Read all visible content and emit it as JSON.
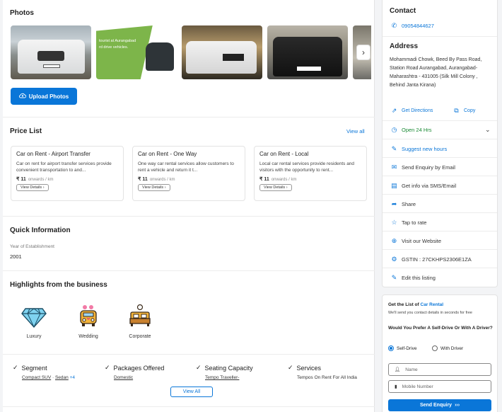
{
  "photos": {
    "title": "Photos",
    "overlay_text_line1": "tourist at Aurangabad",
    "overlay_text_line2": "rd drive vehicles.",
    "upload_label": "Upload Photos"
  },
  "price_list": {
    "title": "Price List",
    "view_all": "View all",
    "cards": [
      {
        "title": "Car on Rent - Airport Transfer",
        "desc": "Car on rent for airport transfer services provide convenient transportation to and...",
        "price": "₹ 11",
        "unit": "onwards / km",
        "button": "View Details"
      },
      {
        "title": "Car on Rent - One Way",
        "desc": "One way car rental services allow customers to rent a vehicle and return it t...",
        "price": "₹ 11",
        "unit": "onwards / km",
        "button": "View Details"
      },
      {
        "title": "Car on Rent - Local",
        "desc": "Local car rental services provide residents and visitors with the opportunity to rent...",
        "price": "₹ 11",
        "unit": "onwards / km",
        "button": "View Details"
      }
    ]
  },
  "quick_info": {
    "title": "Quick Information",
    "label": "Year of Establishment",
    "value": "2001"
  },
  "highlights": {
    "title": "Highlights from the business",
    "items": [
      {
        "label": "Luxury",
        "icon": "diamond-icon"
      },
      {
        "label": "Wedding",
        "icon": "wedding-car-icon"
      },
      {
        "label": "Corporate",
        "icon": "corporate-bed-icon"
      }
    ]
  },
  "features": {
    "items": [
      {
        "title": "Segment",
        "value_a": "Compact SUV",
        "value_b": "Sedan",
        "extra": "+4"
      },
      {
        "title": "Packages Offered",
        "value_a": "Domestic",
        "value_b": "",
        "extra": ""
      },
      {
        "title": "Seating Capacity",
        "value_a": "Tempo Traveller-",
        "value_b": "",
        "extra": ""
      },
      {
        "title": "Services",
        "value_a": "Tempos On Rent For All India",
        "value_b": "",
        "extra": ""
      }
    ],
    "view_all": "View All"
  },
  "side": {
    "contact_title": "Contact",
    "phone": "09054844627",
    "address_title": "Address",
    "address": "Mohammadi Chowk, Beed By Pass Road, Station Road Aurangabad, Aurangabad-Maharashtra - 431005 (Silk Mill Colony , Behind Janta Kirana)",
    "get_directions": "Get Directions",
    "copy": "Copy",
    "hours": "Open 24 Hrs",
    "suggest_hours": "Suggest new hours",
    "send_email": "Send Enquiry by Email",
    "sms": "Get info via SMS/Email",
    "share": "Share",
    "tap_rate": "Tap to rate",
    "website": "Visit our Website",
    "gstin": "GSTIN : 27CKHPS2306E1ZA",
    "edit": "Edit this listing"
  },
  "enquiry": {
    "heading_prefix": "Get the List of",
    "heading_link": "Car Rental",
    "subheading": "We'll send you contact details in seconds for free",
    "question": "Would You Prefer A Self-Drive Or With A Driver?",
    "option_self": "Self-Drive",
    "option_driver": "With Driver",
    "name_placeholder": "Name",
    "mobile_placeholder": "Mobile Number",
    "send_label": "Send Enquiry",
    "send_arrows": "›››"
  },
  "colors": {
    "accent": "#0a76d8",
    "green": "#1a8a34"
  }
}
